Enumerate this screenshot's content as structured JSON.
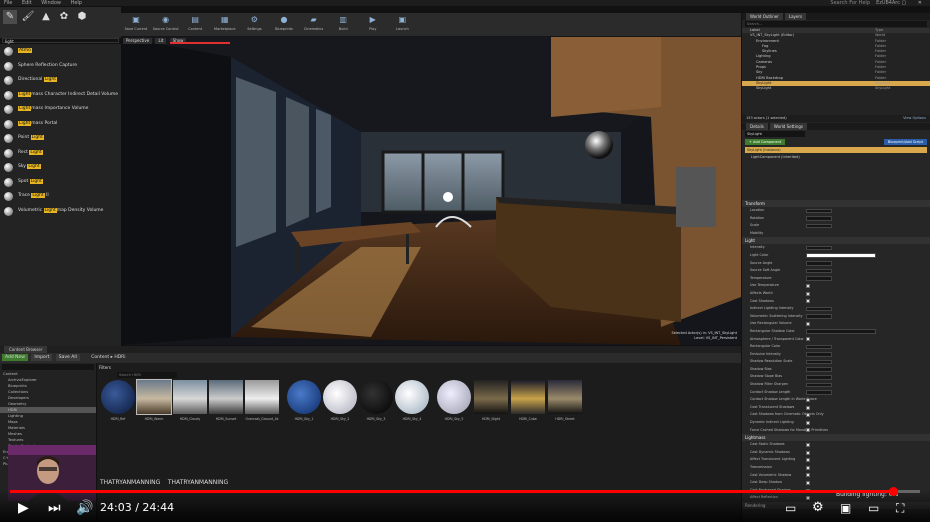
{
  "titlebar": {
    "menus": [
      "File",
      "Edit",
      "Window",
      "Help"
    ],
    "project": "EzUE4Arc",
    "search_placeholder": "Search For Help"
  },
  "modes": {
    "tabs": [
      "place-mode",
      "paint-mode",
      "landscape-mode",
      "foliage-mode",
      "geometry-mode"
    ]
  },
  "place": {
    "search_value": "light",
    "items": [
      {
        "pre": "",
        "hl": "Atmo",
        "post": "",
        "full": "Atmo"
      },
      {
        "pre": "Sphere Reflection ",
        "hl": "",
        "post": "Capture",
        "full": ""
      },
      {
        "pre": "Directional ",
        "hl": "Light",
        "post": ""
      },
      {
        "pre": "",
        "hl": "Light",
        "post": "mass Character Indirect Detail Volume"
      },
      {
        "pre": "",
        "hl": "Light",
        "post": "mass Importance Volume"
      },
      {
        "pre": "",
        "hl": "Light",
        "post": "mass Portal"
      },
      {
        "pre": "Point ",
        "hl": "Light",
        "post": ""
      },
      {
        "pre": "Rect ",
        "hl": "Light",
        "post": ""
      },
      {
        "pre": "Sky ",
        "hl": "Light",
        "post": ""
      },
      {
        "pre": "Spot ",
        "hl": "Light",
        "post": ""
      },
      {
        "pre": "Trace ",
        "hl": "Light",
        "post": " II"
      },
      {
        "pre": "Volumetric ",
        "hl": "Light",
        "post": "map Density Volume"
      }
    ]
  },
  "toolbar": {
    "buttons": [
      "Save Current",
      "Source Control",
      "Content",
      "Marketplace",
      "Settings",
      "Blueprints",
      "Cinematics",
      "Build",
      "Play",
      "Launch"
    ]
  },
  "viewport": {
    "top_buttons": [
      "Perspective",
      "Lit",
      "Show"
    ],
    "info_line1": "Selected Actor(s) in: VS_INT_SkyLight",
    "info_line2": "Level: VS_INT_Persistent"
  },
  "outliner": {
    "tabs": [
      "World Outliner",
      "Layers"
    ],
    "search_placeholder": "Search...",
    "col_label": "Label",
    "col_type": "Type",
    "rows": [
      {
        "label": "VS_INT_SkyLight (Editor)",
        "type": "World",
        "sel": false
      },
      {
        "label": "Environment",
        "type": "Folder",
        "sel": false
      },
      {
        "label": "Fog",
        "type": "Folder",
        "sel": false
      },
      {
        "label": "Skylines",
        "type": "Folder",
        "sel": false
      },
      {
        "label": "Lighting",
        "type": "Folder",
        "sel": false
      },
      {
        "label": "Cameras",
        "type": "Folder",
        "sel": false
      },
      {
        "label": "Props",
        "type": "Folder",
        "sel": false
      },
      {
        "label": "Sky",
        "type": "Folder",
        "sel": false
      },
      {
        "label": "HDRi Backdrop",
        "type": "Folder",
        "sel": false
      },
      {
        "label": "SkyLight",
        "type": "SkyLight",
        "sel": true
      },
      {
        "label": "SkyLight",
        "type": "SkyLight",
        "sel": false
      }
    ],
    "count": "153 actors (1 selected)",
    "view_options": "View Options"
  },
  "details": {
    "tabs": [
      "Details",
      "World Settings"
    ],
    "actor_name": "SkyLight",
    "add_component": "+ Add Component",
    "blueprint": "Blueprint/Add Script",
    "component_row": "SkyLight (Instance)",
    "component_child": "LightComponent (Inherited)",
    "sections": [
      {
        "title": "Transform",
        "rows": [
          "Location",
          "Rotation",
          "Scale",
          "Mobility"
        ]
      },
      {
        "title": "Light",
        "rows": [
          "Intensity",
          "Light Color",
          "Source Angle",
          "Source Soft Angle",
          "Temperature",
          "Use Temperature",
          "Affects World",
          "Cast Shadows",
          "Indirect Lighting Intensity",
          "Volumetric Scattering Intensity"
        ]
      },
      {
        "title": "",
        "rows": [
          "Use Rectangular Volume",
          "Rectangular Shadow Color",
          "Atmosphere / Transparent Color",
          "Rectangular Color",
          "Emissive Intensity",
          "Shadow Resolution Scale",
          "Shadow Bias",
          "Shadow Slope Bias",
          "Shadow Filter Sharpen",
          "Contact Shadow Length",
          "Contact Shadow Length In World Space",
          "Cast Translucent Shadows",
          "Cast Shadows from Cinematic Objects Only",
          "Dynamic Indirect Lighting",
          "Force Cached Shadows for Movable Primitives"
        ]
      },
      {
        "title": "Lightmass",
        "rows": [
          "Cast Static Shadows",
          "Cast Dynamic Shadows",
          "Affect Translucent Lighting",
          "Transmission",
          "Cast Volumetric Shadow",
          "Cast Deep Shadow",
          "Cast Raytraced Shadow",
          "Affect Reflection"
        ]
      },
      {
        "title": "Rendering",
        "rows": [
          "Visible",
          "Actor Hidden In Game",
          "Editor Billboard Scale"
        ]
      }
    ]
  },
  "content_browser": {
    "tab": "Content Browser",
    "add_new": "Add New",
    "import": "Import",
    "save_all": "Save All",
    "path": [
      "Content",
      "HDRi"
    ],
    "filters": "Filters",
    "search_placeholder": "Search HDRi",
    "folders": [
      "Content",
      "ArchvizExplorer",
      "Blueprints",
      "Collections",
      "Developers",
      "Geometry",
      "HDRi",
      "Lighting",
      "Maps",
      "Materials",
      "Meshes",
      "Textures",
      "StarterContent",
      "Engine",
      "C++ Classes",
      "Plugins"
    ],
    "assets": [
      "HDRi_Ref",
      "HDRi_Warm",
      "HDRi_Cloudy",
      "HDRi_Sunset",
      "Overcast_Ground_4k",
      "HDRi_Sky_1",
      "HDRi_Sky_2",
      "HDRi_Sky_3",
      "HDRi_Sky_4",
      "HDRi_Sky_5",
      "HDRi_Night",
      "HDRi_Cube",
      "HDRi_Street"
    ]
  },
  "status": {
    "building": "Building lighting: 0%"
  },
  "video": {
    "time": "24:03 / 24:44",
    "progress": 0.97,
    "channels": [
      "THATRYANMANNING",
      "THATRYANMANNING"
    ]
  }
}
